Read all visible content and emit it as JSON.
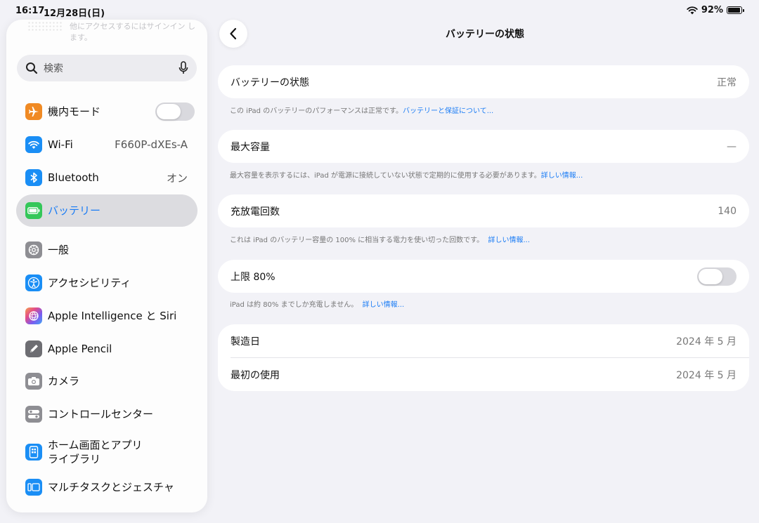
{
  "status": {
    "time": "16:17",
    "date": "12月28日(日)",
    "battery_percent": "92%",
    "battery_level": 0.92
  },
  "sidebar": {
    "top_text": "他にアクセスするにはサインイン します。",
    "search_placeholder": "検索",
    "items": [
      {
        "label": "機内モード",
        "icon": "airplane-icon",
        "color": "#f08a24",
        "toggle_on": false
      },
      {
        "label": "Wi-Fi",
        "value": "F660P-dXEs-A",
        "icon": "wifi-icon",
        "color": "#1a8ef5"
      },
      {
        "label": "Bluetooth",
        "value": "オン",
        "icon": "bluetooth-icon",
        "color": "#1a8ef5"
      },
      {
        "label": "バッテリー",
        "icon": "battery-icon",
        "color": "#34c759",
        "selected": true
      },
      {
        "label": "一般",
        "icon": "gear-icon",
        "color": "#8e8e93"
      },
      {
        "label": "アクセシビリティ",
        "icon": "accessibility-icon",
        "color": "#1a8ef5"
      },
      {
        "label": "Apple Intelligence と Siri",
        "icon": "siri-icon",
        "color": "#c86adf"
      },
      {
        "label": "Apple Pencil",
        "icon": "pencil-icon",
        "color": "#6d6d72"
      },
      {
        "label": "カメラ",
        "icon": "camera-icon",
        "color": "#8e8e93"
      },
      {
        "label": "コントロールセンター",
        "icon": "control-center-icon",
        "color": "#8e8e93"
      },
      {
        "label": "ホーム画面とアプリ",
        "label2": "ライブラリ",
        "icon": "home-screen-icon",
        "color": "#1a8ef5"
      },
      {
        "label": "マルチタスクとジェスチャ",
        "icon": "multitask-icon",
        "color": "#1a8ef5"
      }
    ]
  },
  "main": {
    "title": "バッテリーの状態",
    "health": {
      "label": "バッテリーの状態",
      "value": "正常"
    },
    "health_note": "この iPad のバッテリーのパフォーマンスは正常です。",
    "health_link": "バッテリーと保証について...",
    "capacity": {
      "label": "最大容量",
      "value": "—"
    },
    "capacity_note": "最大容量を表示するには、iPad が電源に接続していない状態で定期的に使用する必要があります。",
    "capacity_link": "詳しい情報...",
    "cycles": {
      "label": "充放電回数",
      "value": "140"
    },
    "cycles_note": "これは iPad のバッテリー容量の 100% に相当する電力を使い切った回数です。",
    "cycles_link": "詳しい情報...",
    "limit": {
      "label": "上限 80%",
      "toggle_on": false
    },
    "limit_note": "iPad は約 80% までしか充電しません。",
    "limit_link": "詳しい情報...",
    "manufacture": {
      "label": "製造日",
      "value": "2024 年 5 月"
    },
    "first_use": {
      "label": "最初の使用",
      "value": "2024 年 5 月"
    }
  }
}
